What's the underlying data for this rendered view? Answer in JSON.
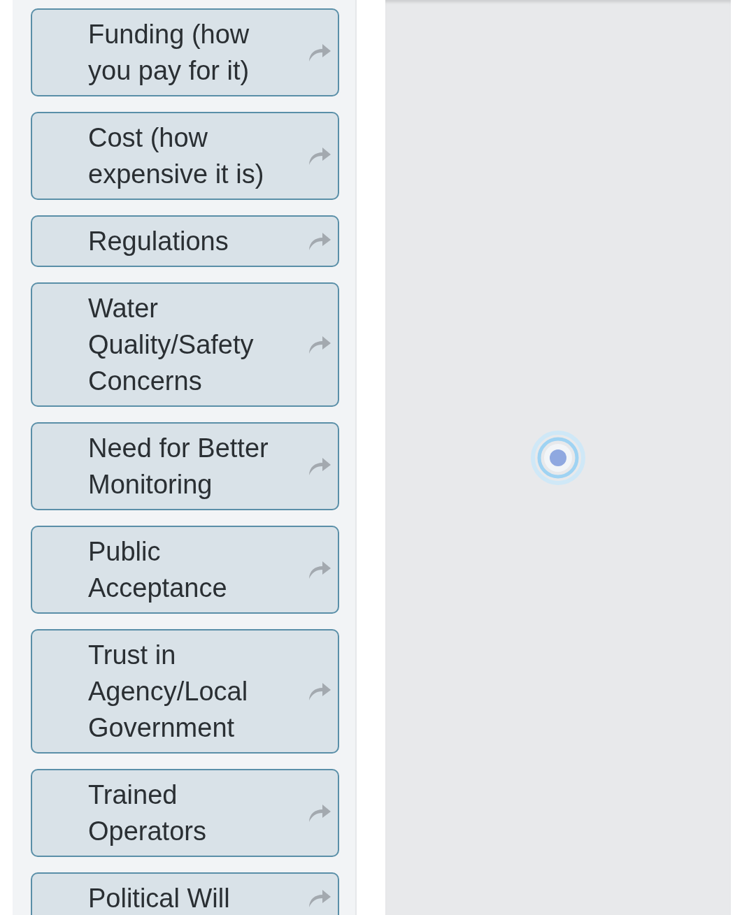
{
  "items": [
    {
      "label": "Funding (how you pay for it)"
    },
    {
      "label": "Cost (how expensive it is)"
    },
    {
      "label": "Regulations"
    },
    {
      "label": "Water Quality/Safety Concerns"
    },
    {
      "label": "Need for Better Monitoring"
    },
    {
      "label": "Public Acceptance"
    },
    {
      "label": "Trust in Agency/Local Government"
    },
    {
      "label": "Trained Operators"
    },
    {
      "label": "Political Will"
    }
  ]
}
